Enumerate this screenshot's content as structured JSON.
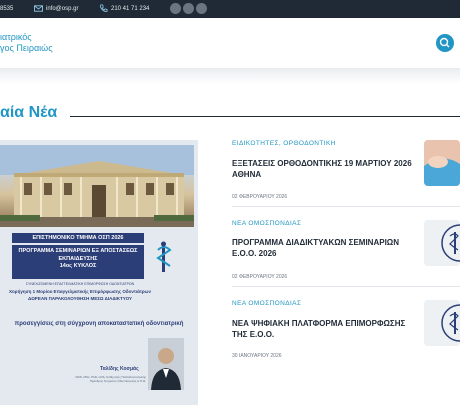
{
  "topbar": {
    "phone_partial": "8535",
    "email": "info@osp.gr",
    "phone": "210 41 71 234",
    "social_icons": [
      "facebook-icon",
      "youtube-icon",
      "instagram-icon"
    ],
    "background": "#1f2a36"
  },
  "header": {
    "logo_line1": "ιατρικός",
    "logo_line2": "γος Πειραιώς",
    "search_icon": "search-icon",
    "accent": "#2196c4"
  },
  "section": {
    "title": "αία Νέα"
  },
  "feature": {
    "banner1": "ΕΠΙΣΤΗΜΟΝΙΚΟ ΤΜΗΜΑ ΟΣΠ 2026",
    "banner2_line1": "ΠΡΟΓΡΑΜΜΑ ΣΕΜΙΝΑΡΙΩΝ ΕΞ ΑΠΟΣΤΑΣΕΩΣ",
    "banner2_line2": "ΕΚΠΑΙΔΕΥΣΗΣ",
    "banner2_line3": "14ος ΚΥΚΛΟΣ",
    "small1": "ΣΥΝΕΧΙΖΟΜΕΝΗ ΕΠΑΓΓΕΛΜΑΤΙΚΗ ΕΠΙΜΟΡΦΩΣΗ ΟΔΟΝΤΙΑΤΡΩΝ",
    "small2": "Χορήγηση 1 Μορίου Επαγγελματικής Επιμόρφωσης Οδοντιάτρων",
    "small3": "ΔΩΡΕΑΝ ΠΑΡΑΚΟΛΟΥΘΗΣΗ ΜΕΣΩ ΔΙΑΔΙΚΤΥΟΥ",
    "quote": "προσεγγίσεις στη σύγχρονη αποκαταστατική οδοντιατρική",
    "person_name": "Ταλίδης Κοσμάς",
    "person_desc_1": "DDS, MSc, PhD, LDS, Καθηγητής Παιδοδοντιατρικής",
    "person_desc_2": "Πρόεδρος Τμήματος Οδοντιατρικής Α.Π.Θ."
  },
  "news": [
    {
      "category": "ΕΙΔΙΚΟΤΗΤΕΣ, ΟΡΘΟΔΟΝΤΙΚΗ",
      "title": "ΕΞΕΤΑΣΕΙΣ ΟΡΘΟΔΟΝΤΙΚΗΣ 19 ΜΑΡΤΙΟΥ 2026 ΑΘΗΝΑ",
      "date": "02 ΦΕΒΡΟΥΑΡΙΟΥ 2026"
    },
    {
      "category": "ΝΕΑ ΟΜΟΣΠΟΝΔΙΑΣ",
      "title": "ΠΡΟΓΡΑΜΜΑ ΔΙΑΔΙΚΤΥΑΚΩΝ ΣΕΜΙΝΑΡΙΩΝ Ε.Ο.Ο. 2026",
      "date": "02 ΦΕΒΡΟΥΑΡΙΟΥ 2026"
    },
    {
      "category": "ΝΕΑ ΟΜΟΣΠΟΝΔΙΑΣ",
      "title": "ΝΕΑ ΨΗΦΙΑΚΗ ΠΛΑΤΦΟΡΜΑ ΕΠΙΜΟΡΦΩΣΗΣ ΤΗΣ Ε.Ο.Ο.",
      "date": "30 ΙΑΝΟΥΑΡΙΟΥ 2026"
    }
  ]
}
